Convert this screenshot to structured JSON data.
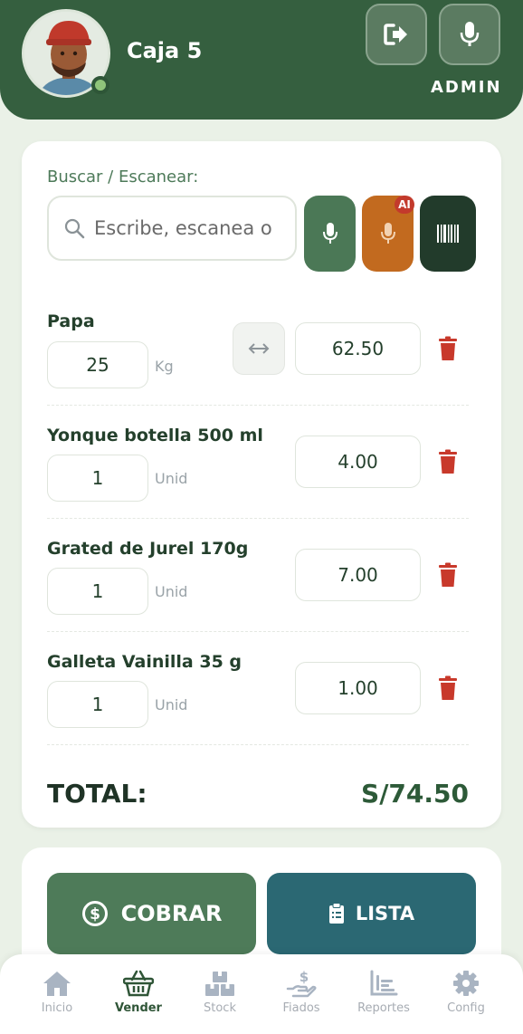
{
  "header": {
    "register_name": "Caja 5",
    "role": "ADMIN",
    "logout_icon": "logout-icon",
    "mic_icon": "microphone-icon",
    "online_status_color": "#8fc47a"
  },
  "search": {
    "label": "Buscar / Escanear:",
    "placeholder": "Escribe, escanea o habla...",
    "ai_badge": "AI"
  },
  "cart": {
    "items": [
      {
        "name": "Papa",
        "qty": "25",
        "unit": "Kg",
        "price": "62.50"
      },
      {
        "name": "Yonque botella 500 ml",
        "qty": "1",
        "unit": "Unid",
        "price": "4.00"
      },
      {
        "name": "Grated de Jurel 170g",
        "qty": "1",
        "unit": "Unid",
        "price": "7.00"
      },
      {
        "name": "Galleta Vainilla 35 g",
        "qty": "1",
        "unit": "Unid",
        "price": "1.00"
      }
    ],
    "total_label": "TOTAL:",
    "total_value": "S/74.50"
  },
  "actions": {
    "charge_label": "COBRAR",
    "list_label": "LISTA"
  },
  "nav": {
    "items": [
      {
        "label": "Inicio",
        "icon": "home-icon",
        "active": false
      },
      {
        "label": "Vender",
        "icon": "basket-icon",
        "active": true
      },
      {
        "label": "Stock",
        "icon": "boxes-icon",
        "active": false
      },
      {
        "label": "Fiados",
        "icon": "credit-hand-icon",
        "active": false
      },
      {
        "label": "Reportes",
        "icon": "chart-icon",
        "active": false
      },
      {
        "label": "Config",
        "icon": "gear-icon",
        "active": false
      }
    ]
  },
  "colors": {
    "primary": "#355f3f",
    "accent_orange": "#c26a1f",
    "dark_green": "#223b2b",
    "teal": "#2b6873",
    "danger": "#c8392b"
  }
}
